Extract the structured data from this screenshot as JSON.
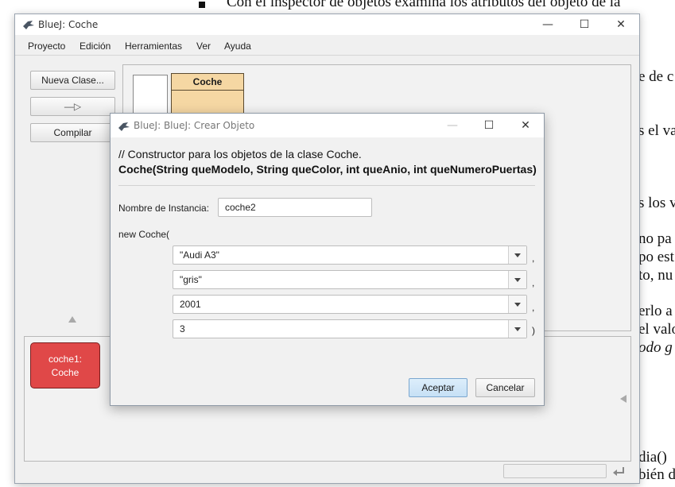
{
  "background_document": {
    "lines": [
      "Con el inspector de objetos examina los atributos del objeto de la",
      "e de c",
      "s el va",
      "s los v",
      "no pa",
      "po est",
      "to, nu",
      "erlo a",
      "el valo",
      "odo g",
      "dia()",
      "bién d"
    ]
  },
  "main_window": {
    "title": "BlueJ: Coche",
    "controls": {
      "minimize": "—",
      "maximize": "☐",
      "close": "✕"
    },
    "menu": [
      "Proyecto",
      "Edición",
      "Herramientas",
      "Ver",
      "Ayuda"
    ],
    "toolbar": {
      "new_class": "Nueva Clase...",
      "arrow": "—▷",
      "compile": "Compilar"
    },
    "class_diagram": {
      "class_name": "Coche"
    },
    "object_bench": {
      "objects": [
        {
          "line1": "coche1:",
          "line2": "Coche"
        }
      ]
    }
  },
  "dialog": {
    "title": "BlueJ:  BlueJ:  Crear Objeto",
    "comment": "// Constructor para los objetos de la clase Coche.",
    "signature": "Coche(String queModelo, String queColor, int queAnio, int queNumeroPuertas)",
    "instance_label": "Nombre de Instancia:",
    "instance_value": "coche2",
    "new_label": "new Coche(",
    "params": [
      "\"Audi A3\"",
      "\"gris\"",
      "2001",
      "3"
    ],
    "separators": [
      ",",
      ",",
      ",",
      ")"
    ],
    "accept": "Aceptar",
    "cancel": "Cancelar"
  },
  "colors": {
    "object": "#e04848",
    "class": "#f5d7a3",
    "accent_button": "#cfe4f7"
  }
}
